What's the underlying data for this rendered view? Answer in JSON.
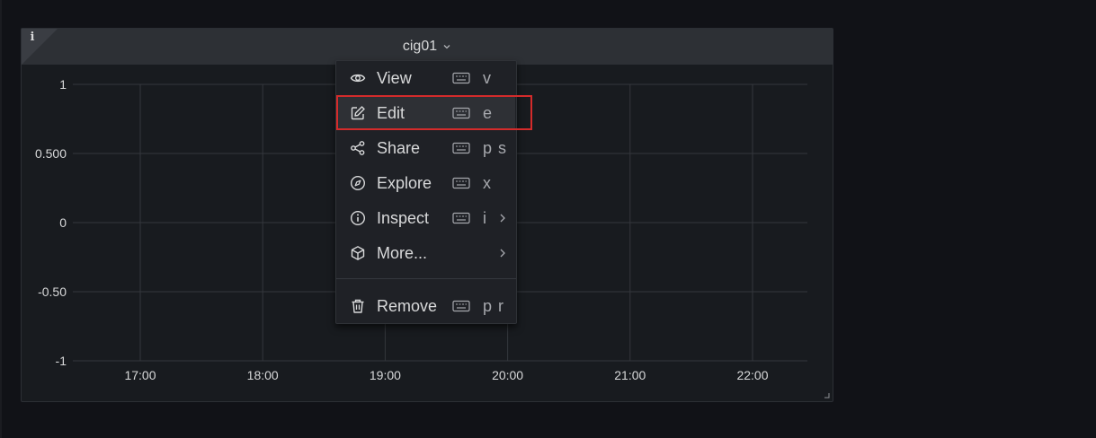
{
  "panel": {
    "title": "cig01",
    "info_icon": "info-icon"
  },
  "chart_data": {
    "type": "line",
    "title": "cig01",
    "x_ticks": [
      "17:00",
      "18:00",
      "19:00",
      "20:00",
      "21:00",
      "22:00"
    ],
    "y_ticks": [
      "1",
      "0.500",
      "0",
      "-0.50",
      "-1"
    ],
    "ylim": [
      -1,
      1
    ],
    "series": [],
    "grid": true
  },
  "menu": {
    "items": [
      {
        "label": "View",
        "shortcut": "v",
        "icon": "eye-icon"
      },
      {
        "label": "Edit",
        "shortcut": "e",
        "icon": "edit-icon"
      },
      {
        "label": "Share",
        "shortcut": "p s",
        "icon": "share-icon"
      },
      {
        "label": "Explore",
        "shortcut": "x",
        "icon": "compass-icon"
      },
      {
        "label": "Inspect",
        "shortcut": "i",
        "icon": "info-circle-icon"
      },
      {
        "label": "More...",
        "shortcut": "",
        "icon": "cube-icon"
      },
      {
        "label": "Remove",
        "shortcut": "p r",
        "icon": "trash-icon"
      }
    ]
  },
  "colors": {
    "background": "#111217",
    "panel": "#181b1f",
    "panel_header": "#2d3035",
    "menu": "#1f2126",
    "highlight": "#d42b2b"
  }
}
